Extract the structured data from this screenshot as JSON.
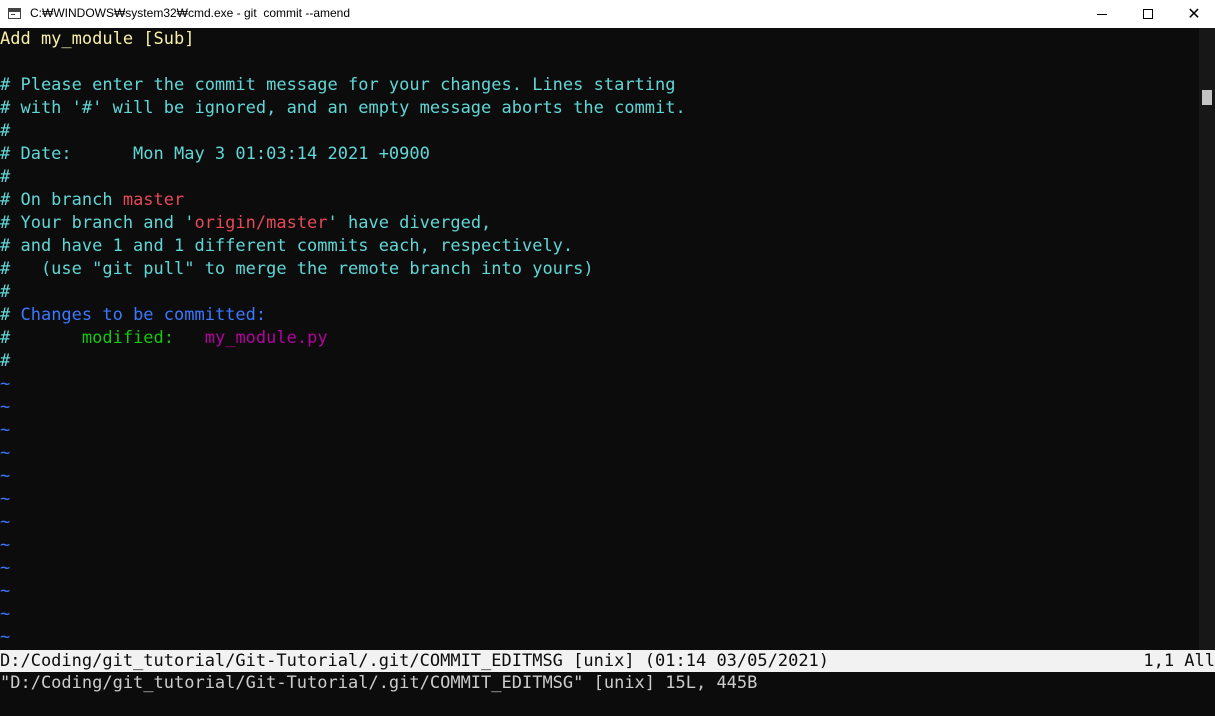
{
  "window": {
    "title": "C:₩WINDOWS₩system32₩cmd.exe - git  commit --amend",
    "icon": "cmd-icon"
  },
  "editor": {
    "subject": "Add my_module [Sub]",
    "lines": {
      "blank1": "",
      "l2": "# Please enter the commit message for your changes. Lines starting",
      "l3": "# with '#' will be ignored, and an empty message aborts the commit.",
      "l4": "#",
      "l5": "# Date:      Mon May 3 01:03:14 2021 +0900",
      "l6": "#",
      "l7_prefix": "# On branch ",
      "l7_branch": "master",
      "l8_prefix": "# Your branch and '",
      "l8_branch": "origin/master",
      "l8_suffix": "' have diverged,",
      "l9": "# and have 1 and 1 different commits each, respectively.",
      "l10": "#   (use \"git pull\" to merge the remote branch into yours)",
      "l11": "#",
      "l12_prefix": "# ",
      "l12_header": "Changes to be committed:",
      "l13_prefix": "#       ",
      "l13_status": "modified:",
      "l13_gap": "   ",
      "l13_file": "my_module.py",
      "l14": "#"
    },
    "tilde": "~"
  },
  "status": {
    "left": "D:/Coding/git_tutorial/Git-Tutorial/.git/COMMIT_EDITMSG [unix] (01:14 03/05/2021)",
    "right": "1,1 All"
  },
  "message": "\"D:/Coding/git_tutorial/Git-Tutorial/.git/COMMIT_EDITMSG\" [unix] 15L, 445B",
  "colors": {
    "background": "#0c0c0c",
    "comment": "#61d6d6",
    "subject": "#f9f1a5",
    "branch": "#e74856",
    "header": "#3b78ff",
    "status_modified": "#16c60c",
    "filename": "#b4009e"
  }
}
